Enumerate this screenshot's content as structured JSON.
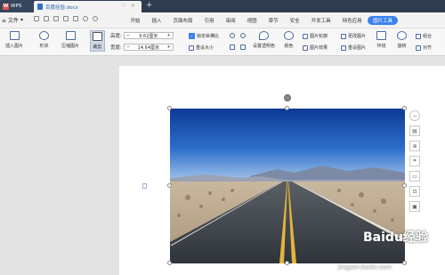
{
  "titlebar": {
    "app_tab": "WPS",
    "doc_tab": "百度经验.docx",
    "new_tab_symbol": "+"
  },
  "menubar": {
    "file_label": "≡ 文件",
    "items": [
      "开始",
      "插入",
      "页面布局",
      "引用",
      "审阅",
      "视图",
      "章节",
      "安全",
      "开发工具",
      "特色应用",
      "图片工具"
    ]
  },
  "ribbon": {
    "insert_picture": "插入图片",
    "shape": "形状",
    "compress_picture": "压缩图片",
    "crop": "裁剪",
    "height_label": "高度:",
    "height_value": "9.62厘米",
    "width_label": "宽度:",
    "width_value": "14.64厘米",
    "lock_ratio": "锁定纵横比",
    "reset_size": "重设大小",
    "set_transparent": "设置透明色",
    "color": "颜色",
    "picture_outline": "图片轮廓",
    "picture_effect": "图片效果",
    "change_picture": "更改图片",
    "reset_picture": "重设图片",
    "wrap": "环绕",
    "rotate": "旋转",
    "combine": "组合",
    "align": "对齐"
  },
  "watermark": {
    "text": "Baidu经验",
    "url": "jingyan.baidu.com"
  },
  "colors": {
    "titlebar": "#2f3c4f",
    "accent": "#3b80f0",
    "sky_top": "#0f3f9a",
    "sky_bottom": "#8fb6e6"
  }
}
